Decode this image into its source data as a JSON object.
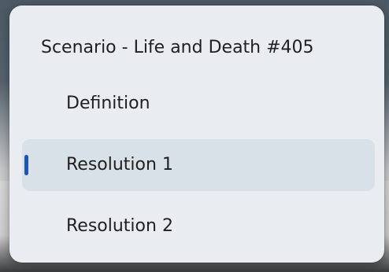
{
  "menu": {
    "title": "Scenario - Life and Death #405",
    "items": [
      {
        "label": "Definition",
        "selected": false
      },
      {
        "label": "Resolution 1",
        "selected": true
      },
      {
        "label": "Resolution 2",
        "selected": false
      }
    ]
  },
  "colors": {
    "menu_background": "#e9edf1",
    "selected_background": "#d9e1e8",
    "accent": "#1f56b5",
    "text": "#1f1f1f"
  }
}
